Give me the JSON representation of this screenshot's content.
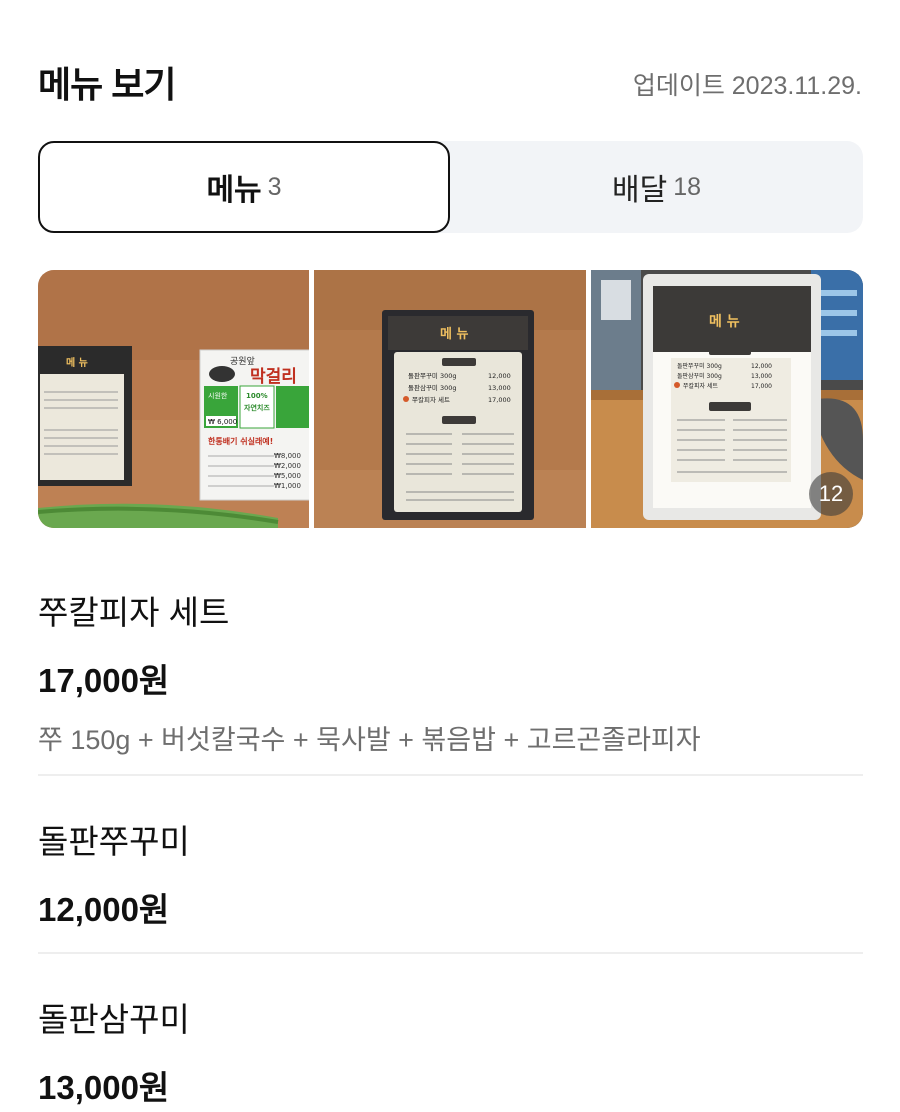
{
  "header": {
    "title": "메뉴 보기",
    "updated": "업데이트 2023.11.29."
  },
  "tabs": [
    {
      "label": "메뉴",
      "count": "3"
    },
    {
      "label": "배달",
      "count": "18"
    }
  ],
  "gallery": {
    "photo1": {
      "board_title": "메 뉴",
      "sign_title": "공원앞",
      "sign_name": "막걸리",
      "sign_box1": "시원한",
      "sign_box2": "100%",
      "sign_box3": "자연치즈",
      "sign_price": "₩ 6,000",
      "sign_line1": "한통배기 쉬실래예!",
      "sign_p1": "₩8,000",
      "sign_p2": "₩2,000",
      "sign_p3": "₩5,000",
      "sign_p4": "₩1,000"
    },
    "photo2": {
      "board_title": "메 뉴",
      "rows": [
        {
          "name": "돌판쭈꾸미 300g",
          "price": "12,000"
        },
        {
          "name": "돌판삼꾸미 300g",
          "price": "13,000"
        },
        {
          "name": "쭈칼피자 세트",
          "price": "17,000"
        }
      ]
    },
    "photo3": {
      "board_title": "메 뉴",
      "rows": [
        {
          "name": "돌판쭈꾸미 300g",
          "price": "12,000"
        },
        {
          "name": "돌판삼꾸미 300g",
          "price": "13,000"
        },
        {
          "name": "쭈칼피자 세트",
          "price": "17,000"
        }
      ]
    },
    "more_count": "12"
  },
  "menu_items": [
    {
      "name": "쭈칼피자 세트",
      "price": "17,000원",
      "desc": "쭈 150g + 버섯칼국수 + 묵사발 + 볶음밥 + 고르곤졸라피자"
    },
    {
      "name": "돌판쭈꾸미",
      "price": "12,000원"
    },
    {
      "name": "돌판삼꾸미",
      "price": "13,000원"
    }
  ]
}
